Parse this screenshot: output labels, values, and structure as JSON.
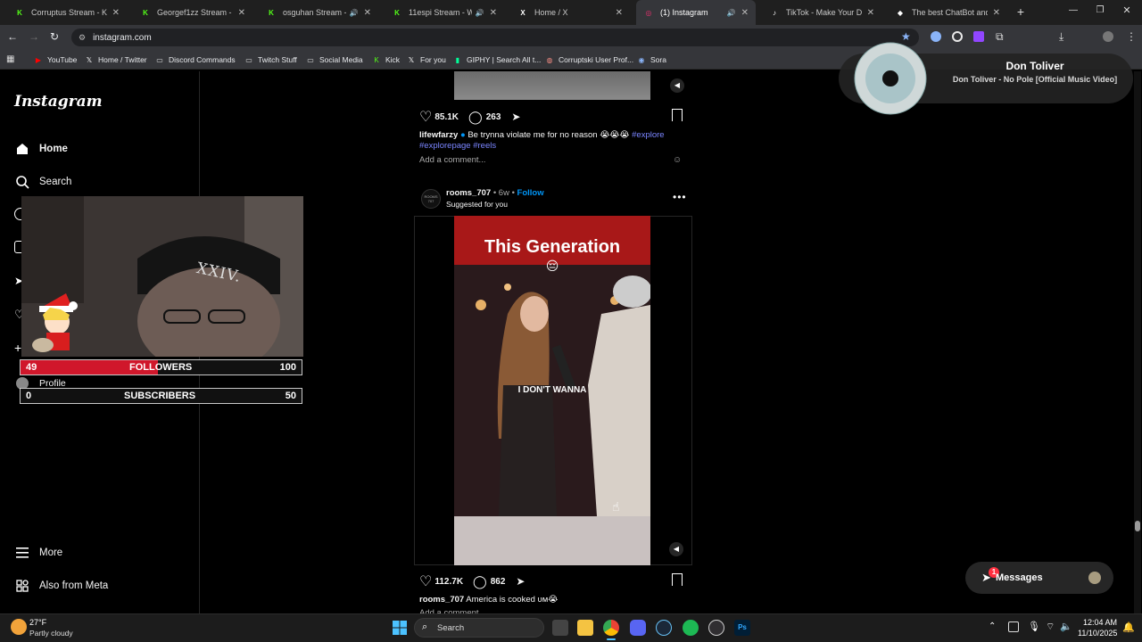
{
  "browser": {
    "tabs": [
      {
        "title": "Corruptus Stream - Kick D...",
        "fav": "K",
        "favColor": "#53fc18",
        "sound": false
      },
      {
        "title": "Georgef1zz Stream - Watc...",
        "fav": "K",
        "favColor": "#53fc18",
        "sound": false
      },
      {
        "title": "osguhan Stream - Kick...",
        "fav": "K",
        "favColor": "#53fc18",
        "sound": true
      },
      {
        "title": "11espi Stream - Watch...",
        "fav": "K",
        "favColor": "#53fc18",
        "sound": true
      },
      {
        "title": "Home / X",
        "fav": "X",
        "favColor": "#ffffff",
        "sound": false
      },
      {
        "title": "(1) Instagram",
        "fav": "◎",
        "favColor": "#e1306c",
        "sound": true
      },
      {
        "title": "TikTok - Make Your Day",
        "fav": "♪",
        "favColor": "#ffffff",
        "sound": false
      },
      {
        "title": "The best ChatBot and Wri...",
        "fav": "◆",
        "favColor": "#ffffff",
        "sound": false
      }
    ],
    "url": "instagram.com",
    "bookmarks": [
      {
        "label": "YouTube",
        "icon": "youtube-icon"
      },
      {
        "label": "Home / Twitter",
        "icon": "x-icon"
      },
      {
        "label": "Discord Commands",
        "icon": "folder-icon"
      },
      {
        "label": "Twitch Stuff",
        "icon": "folder-icon"
      },
      {
        "label": "Social Media",
        "icon": "folder-icon"
      },
      {
        "label": "Kick",
        "icon": "kick-icon"
      },
      {
        "label": "For you",
        "icon": "x-icon"
      },
      {
        "label": "GIPHY | Search All t...",
        "icon": "giphy-icon"
      },
      {
        "label": "Corruptski User Prof...",
        "icon": "globe-icon"
      },
      {
        "label": "Sora",
        "icon": "sora-icon"
      }
    ]
  },
  "instagram": {
    "logo": "Instagram",
    "nav": {
      "home": "Home",
      "search": "Search",
      "profile": "Profile",
      "more": "More",
      "meta": "Also from Meta"
    },
    "post1": {
      "likes": "85.1K",
      "comments": "263",
      "username": "lifewfarzy",
      "caption": "Be trynna violate me for no reason",
      "caption_emoji": "😭😭😭",
      "tags_a": "#explore",
      "tags_b": "#explorepage #reels",
      "add_comment": "Add a comment..."
    },
    "post2": {
      "username": "rooms_707",
      "age": "6w",
      "follow": "Follow",
      "suggested": "Suggested for you",
      "avatar_text": "ROOMS 707",
      "video_title": "This Generation",
      "video_emoji": "😔",
      "subtitle": "I DON'T WANNA",
      "likes": "112.7K",
      "comments": "862",
      "caption": "America is cooked ᴜᴍ😭",
      "add_comment": "Add a comment..."
    },
    "messages": {
      "label": "Messages",
      "badge": "1"
    }
  },
  "overlay": {
    "followers": {
      "current": "49",
      "label": "FOLLOWERS",
      "goal": "100",
      "progress": 0.49
    },
    "subscribers": {
      "current": "0",
      "label": "SUBSCRIBERS",
      "goal": "50",
      "progress": 0
    },
    "cap_text": "XXIV."
  },
  "now_playing": {
    "artist": "Don Toliver",
    "track": "Don Toliver - No Pole [Official Music Video]"
  },
  "taskbar": {
    "weather_temp": "27°F",
    "weather_desc": "Partly cloudy",
    "search": "Search",
    "time": "12:04 AM",
    "date": "11/10/2025"
  },
  "colors": {
    "instagram_blue": "#0095f6",
    "followers_bar": "#d0172b",
    "notification": "#ff3040"
  }
}
